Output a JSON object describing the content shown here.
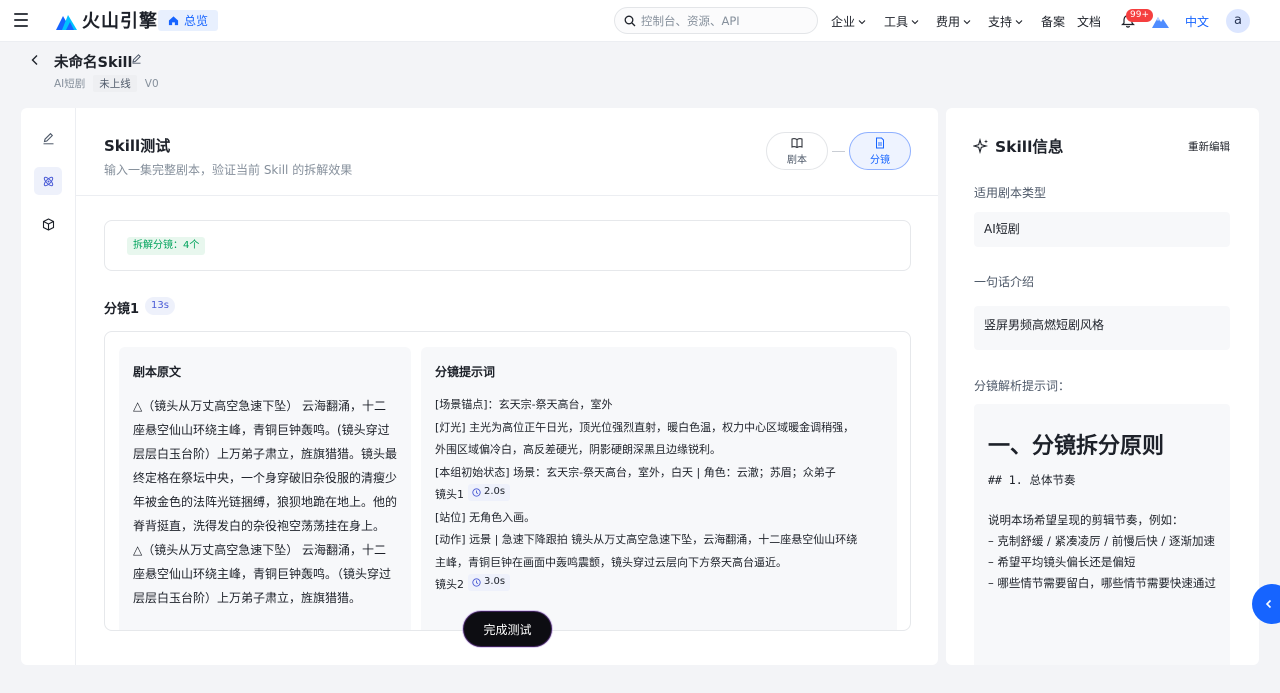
{
  "topnav": {
    "brand": "火山引擎",
    "overview": "总览",
    "search_placeholder": "控制台、资源、API",
    "menus": [
      "企业",
      "工具",
      "费用",
      "支持"
    ],
    "links": [
      "备案",
      "文档"
    ],
    "badge": "99+",
    "lang": "中文",
    "avatar": "a"
  },
  "header": {
    "title": "未命名Skill",
    "category": "AI短剧",
    "status": "未上线",
    "version": "V0"
  },
  "test": {
    "title": "Skill测试",
    "subtitle": "输入一集完整剧本，验证当前 Skill 的拆解效果",
    "steps": [
      "剧本",
      "分镜"
    ]
  },
  "result": {
    "count_tag": "拆解分镜：4个",
    "shot_title": "分镜1",
    "shot_duration": "13s",
    "script_title": "剧本原文",
    "script_text": "△（镜头从万丈高空急速下坠） 云海翻涌，十二座悬空仙山环绕主峰，青铜巨钟轰鸣。(镜头穿过层层白玉台阶）上万弟子肃立，旌旗猎猎。镜头最终定格在祭坛中央，一个身穿破旧杂役服的清瘦少年被金色的法阵光链捆缚，狼狈地跪在地上。他的脊背挺直，洗得发白的杂役袍空荡荡挂在身上。 △（镜头从万丈高空急速下坠） 云海翻涌，十二座悬空仙山环绕主峰，青铜巨钟轰鸣。（镜头穿过层层白玉台阶）上万弟子肃立，旌旗猎猎。",
    "prompt_title": "分镜提示词",
    "prompt_lines": [
      "[场景锚点]：玄天宗-祭天高台，室外",
      "[灯光] 主光为高位正午日光，顶光位强烈直射，暖白色温，权力中心区域暖金调稍强，",
      "外围区域偏冷白，高反差硬光，阴影硬朗深黑且边缘锐利。",
      "[本组初始状态] 场景：玄天宗-祭天高台，室外，白天 | 角色：云澈；苏眉；众弟子"
    ],
    "shot1_label": "镜头1",
    "shot1_time": "2.0s",
    "prompt_lines_2": [
      "[站位] 无角色入画。",
      "[动作] 远景 | 急速下降跟拍 镜头从万丈高空急速下坠，云海翻涌，十二座悬空仙山环绕",
      "主峰，青铜巨钟在画面中轰鸣震颤，镜头穿过云层向下方祭天高台逼近。"
    ],
    "shot2_label": "镜头2",
    "shot2_time": "3.0s",
    "finish_label": "完成测试"
  },
  "info": {
    "title": "Skill信息",
    "re_edit": "重新编辑",
    "type_label": "适用剧本类型",
    "type_value": "AI短剧",
    "intro_label": "一句话介绍",
    "intro_value": "竖屏男频高燃短剧风格",
    "prompt_label": "分镜解析提示词：",
    "md_h1": "一、分镜拆分原则",
    "md_h2": "## 1. 总体节奏",
    "md_lines": [
      "说明本场希望呈现的剪辑节奏，例如：",
      "– 克制舒缓 / 紧凑凌厉 / 前慢后快 / 逐渐加速",
      "– 希望平均镜头偏长还是偏短",
      "– 哪些情节需要留白，哪些情节需要快速通过"
    ]
  },
  "colors": {
    "accent": "#1664ff",
    "success": "#00a35c",
    "badge": "#f53f3f"
  }
}
